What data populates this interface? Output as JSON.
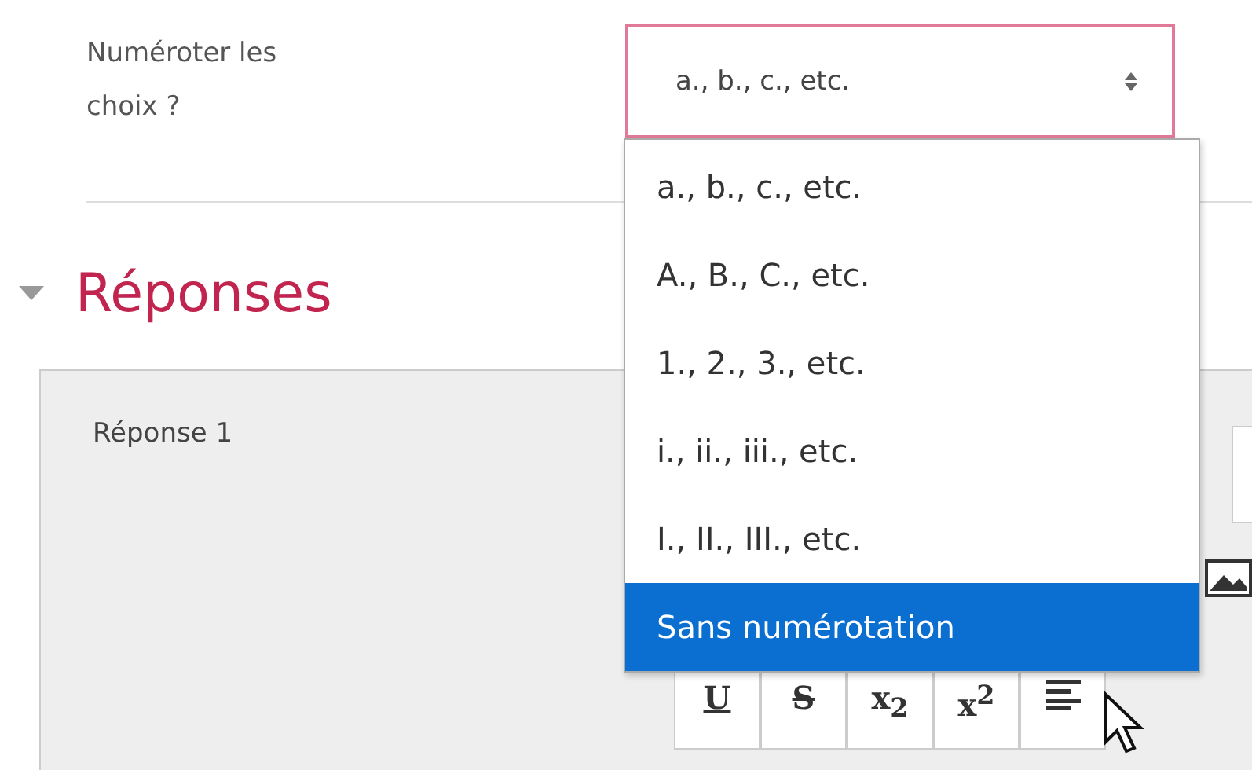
{
  "numbering_field": {
    "label": "Numéroter les choix ?",
    "value": "a., b., c., etc.",
    "expanded": true,
    "options": [
      {
        "label": "a., b., c., etc.",
        "highlighted": false
      },
      {
        "label": "A., B., C., etc.",
        "highlighted": false
      },
      {
        "label": "1., 2., 3., etc.",
        "highlighted": false
      },
      {
        "label": "i., ii., iii., etc.",
        "highlighted": false
      },
      {
        "label": "I., II., III., etc.",
        "highlighted": false
      },
      {
        "label": "Sans numérotation",
        "highlighted": true
      }
    ]
  },
  "section": {
    "title": "Réponses",
    "expanded": true
  },
  "answer": {
    "label": "Réponse 1",
    "toolbar": [
      {
        "kind": "underline",
        "label": "U"
      },
      {
        "kind": "strike",
        "label": "S"
      },
      {
        "kind": "sub",
        "label": "x$_{2}$"
      },
      {
        "kind": "sup",
        "label": "x$^{2}$"
      },
      {
        "kind": "align"
      }
    ]
  }
}
